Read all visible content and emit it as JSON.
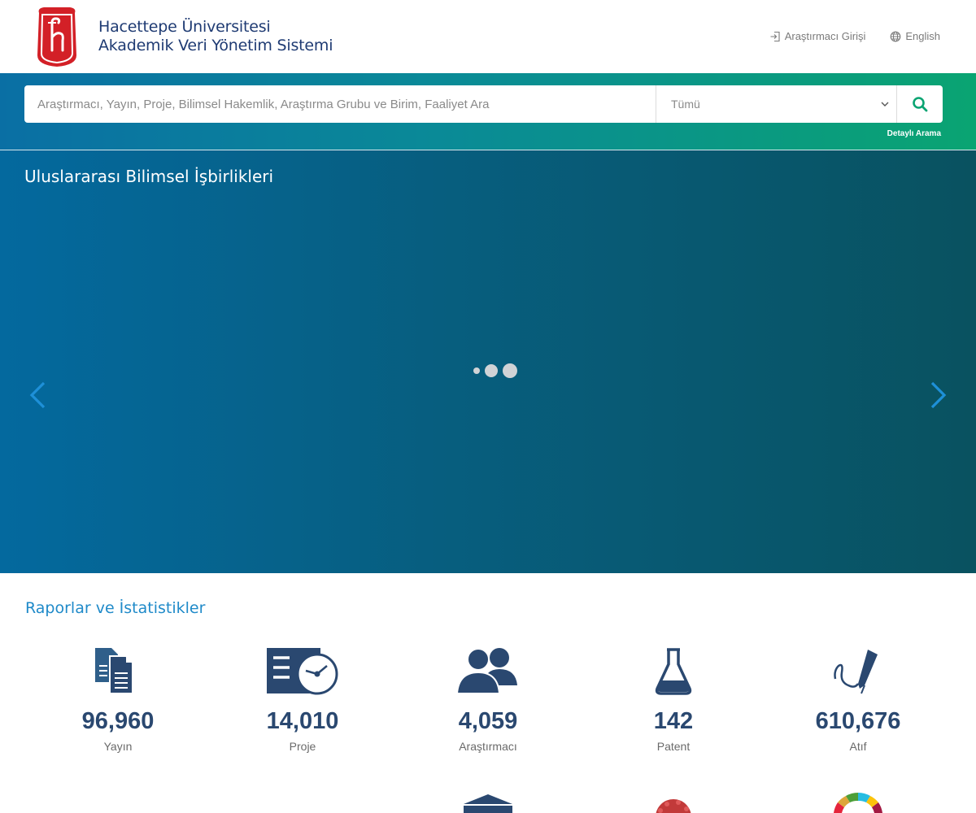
{
  "header": {
    "title_line1": "Hacettepe Üniversitesi",
    "title_line2": "Akademik Veri Yönetim Sistemi",
    "login_label": "Araştırmacı Girişi",
    "language_label": "English"
  },
  "search": {
    "placeholder": "Araştırmacı, Yayın, Proje, Bilimsel Hakemlik, Araştırma Grubu ve Birim, Faaliyet Ara",
    "category_selected": "Tümü",
    "detail_link": "Detaylı Arama"
  },
  "hero": {
    "title": "Uluslararası Bilimsel İşbirlikleri",
    "slide_count": 3,
    "active_slide": 1
  },
  "stats": {
    "title": "Raporlar ve İstatistikler",
    "items": [
      {
        "value": "96,960",
        "label": "Yayın",
        "icon": "documents-icon"
      },
      {
        "value": "14,010",
        "label": "Proje",
        "icon": "project-clock-icon"
      },
      {
        "value": "4,059",
        "label": "Araştırmacı",
        "icon": "people-icon"
      },
      {
        "value": "142",
        "label": "Patent",
        "icon": "flask-icon"
      },
      {
        "value": "610,676",
        "label": "Atıf",
        "icon": "pen-signature-icon"
      }
    ]
  },
  "colors": {
    "brand_red": "#d32027",
    "title_blue": "#1f3b73",
    "accent_blue": "#1f8ac9",
    "stat_navy": "#2a4870",
    "search_accent": "#0aa472"
  }
}
